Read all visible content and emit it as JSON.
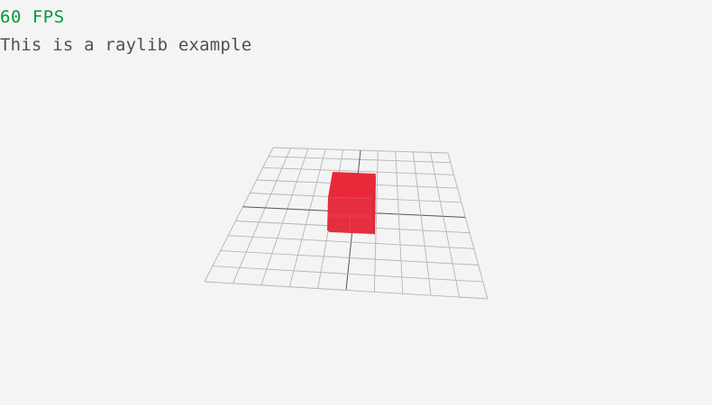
{
  "hud": {
    "fps_text": "60 FPS",
    "fps_color": "#009a3a",
    "message": "This is a raylib example",
    "message_color": "#505050"
  },
  "scene": {
    "background": "#f4f4f4",
    "grid_color": "#b5b5b5",
    "grid_axis_color": "#555555",
    "grid_divisions": 10,
    "cube_color": "#e6293b",
    "cube_front_color": "#e52e3f",
    "cube_top_color": "#e92839",
    "cube_side_color": "#d92636"
  }
}
